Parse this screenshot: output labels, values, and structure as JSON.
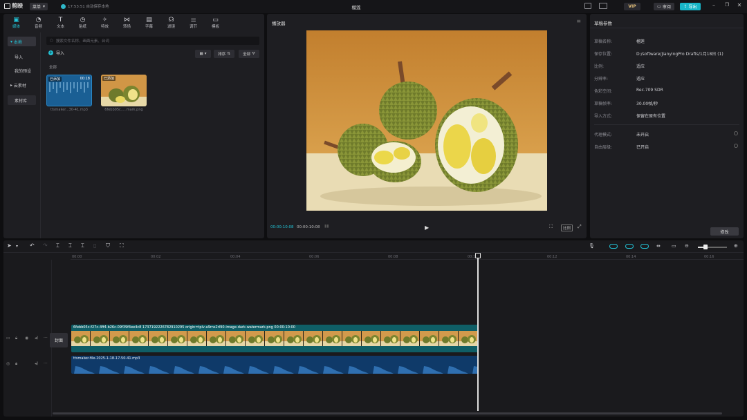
{
  "titlebar": {
    "app_name": "剪映",
    "menu_label": "菜单",
    "autosave_text": "17:53:51 自动保存本地",
    "document_title": "榴莲",
    "review_label": "审阅",
    "export_label": "导出",
    "vip_label": "VIP"
  },
  "media": {
    "tabs": [
      {
        "label": "媒体",
        "icon": "media-icon"
      },
      {
        "label": "音频",
        "icon": "audio-icon"
      },
      {
        "label": "文本",
        "icon": "text-icon"
      },
      {
        "label": "贴纸",
        "icon": "sticker-icon"
      },
      {
        "label": "特效",
        "icon": "effects-icon"
      },
      {
        "label": "转场",
        "icon": "transition-icon"
      },
      {
        "label": "字幕",
        "icon": "subtitle-icon"
      },
      {
        "label": "滤镜",
        "icon": "filter-icon"
      },
      {
        "label": "调节",
        "icon": "adjust-icon"
      },
      {
        "label": "模板",
        "icon": "template-icon"
      }
    ],
    "sidebar": {
      "local": "本地",
      "import": "导入",
      "my_presets": "我的预设",
      "cloud": "云素材",
      "library": "素材库"
    },
    "search_placeholder": "搜索文件名称、画面元素、台词",
    "import_label": "导入",
    "sort_label": "排序",
    "all_filter_label": "全部",
    "all_label": "全部",
    "items": [
      {
        "added": "已添加",
        "duration": "00:18",
        "caption": "ttsmaker...30-41.mp3"
      },
      {
        "added": "已添加",
        "duration": "",
        "caption": "6febb05c.....mark.png"
      }
    ]
  },
  "player": {
    "title": "播放器",
    "time_current": "00:00:10:08",
    "time_total": "00:00:10:08",
    "ratio_label": "比例"
  },
  "params": {
    "title": "草稿参数",
    "rows": [
      {
        "label": "草稿名称:",
        "value": "榴莲"
      },
      {
        "label": "保存位置:",
        "value": "D:/software/JianyingPro Drafts/1月18日 (1)"
      },
      {
        "label": "比例:",
        "value": "适应"
      },
      {
        "label": "分辨率:",
        "value": "适应"
      },
      {
        "label": "色彩空间:",
        "value": "Rec.709 SDR"
      },
      {
        "label": "草稿帧率:",
        "value": "30.00帧/秒"
      },
      {
        "label": "导入方式:",
        "value": "保留在原有位置"
      }
    ],
    "rows2": [
      {
        "label": "代理模式:",
        "value": "未开启"
      },
      {
        "label": "自由层级:",
        "value": "已开启"
      }
    ],
    "modify_label": "修改"
  },
  "timeline": {
    "ticks": [
      "00:00",
      "00:02",
      "00:04",
      "00:06",
      "00:08",
      "00:10",
      "00:12",
      "00:14",
      "00:16"
    ],
    "cover_label": "封面",
    "video_clip_label": "6febb05c-f27c-4ff4-b26c-09f39f4ee4c8 1737192226782910295 origin=tplv-a9rns2rl90-image-dark-watermark.png  00:00:10:00",
    "audio_clip_label": "ttsmaker-file-2025-1-18-17-50-41.mp3"
  },
  "colors": {
    "accent": "#22c3d6",
    "video_track": "#0f5e66",
    "audio_track": "#0f3a69"
  }
}
